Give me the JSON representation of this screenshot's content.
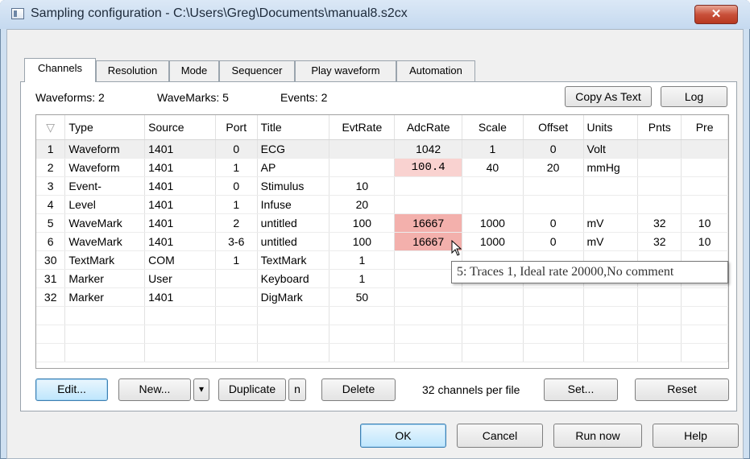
{
  "window": {
    "title": "Sampling configuration - C:\\Users\\Greg\\Documents\\manual8.s2cx",
    "close": "✕"
  },
  "tabs": [
    "Channels",
    "Resolution",
    "Mode",
    "Sequencer",
    "Play waveform",
    "Automation"
  ],
  "summary": {
    "waveforms": "Waveforms: 2",
    "wavemarks": "WaveMarks: 5",
    "events": "Events: 2"
  },
  "top_buttons": {
    "copy": "Copy As Text",
    "log": "Log"
  },
  "table": {
    "sort_indicator": "▽",
    "columns": [
      "Type",
      "Source",
      "Port",
      "Title",
      "EvtRate",
      "AdcRate",
      "Scale",
      "Offset",
      "Units",
      "Pnts",
      "Pre"
    ],
    "rows": [
      {
        "num": "1",
        "type": "Waveform",
        "source": "1401",
        "port": "0",
        "title": "ECG",
        "evtrate": "",
        "adcrate": "1042",
        "scale": "1",
        "offset": "0",
        "units": "Volt",
        "pnts": "",
        "pre": ""
      },
      {
        "num": "2",
        "type": "Waveform",
        "source": "1401",
        "port": "1",
        "title": "AP",
        "evtrate": "",
        "adcrate": "100.4",
        "scale": "40",
        "offset": "20",
        "units": "mmHg",
        "pnts": "",
        "pre": ""
      },
      {
        "num": "3",
        "type": "Event-",
        "source": "1401",
        "port": "0",
        "title": "Stimulus",
        "evtrate": "10",
        "adcrate": "",
        "scale": "",
        "offset": "",
        "units": "",
        "pnts": "",
        "pre": ""
      },
      {
        "num": "4",
        "type": "Level",
        "source": "1401",
        "port": "1",
        "title": "Infuse",
        "evtrate": "20",
        "adcrate": "",
        "scale": "",
        "offset": "",
        "units": "",
        "pnts": "",
        "pre": ""
      },
      {
        "num": "5",
        "type": "WaveMark",
        "source": "1401",
        "port": "2",
        "title": "untitled",
        "evtrate": "100",
        "adcrate": "16667",
        "scale": "1000",
        "offset": "0",
        "units": "mV",
        "pnts": "32",
        "pre": "10"
      },
      {
        "num": "6",
        "type": "WaveMark",
        "source": "1401",
        "port": "3-6",
        "title": "untitled",
        "evtrate": "100",
        "adcrate": "16667",
        "scale": "1000",
        "offset": "0",
        "units": "mV",
        "pnts": "32",
        "pre": "10"
      },
      {
        "num": "30",
        "type": "TextMark",
        "source": "COM",
        "port": "1",
        "title": "TextMark",
        "evtrate": "1",
        "adcrate": "",
        "scale": "",
        "offset": "",
        "units": "",
        "pnts": "",
        "pre": ""
      },
      {
        "num": "31",
        "type": "Marker",
        "source": "User",
        "port": "",
        "title": "Keyboard",
        "evtrate": "1",
        "adcrate": "",
        "scale": "",
        "offset": "",
        "units": "",
        "pnts": "",
        "pre": ""
      },
      {
        "num": "32",
        "type": "Marker",
        "source": "1401",
        "port": "",
        "title": "DigMark",
        "evtrate": "50",
        "adcrate": "",
        "scale": "",
        "offset": "",
        "units": "",
        "pnts": "",
        "pre": ""
      }
    ]
  },
  "tooltip": "5: Traces 1, Ideal rate 20000,No comment",
  "bottom_bar": {
    "edit": "Edit...",
    "new": "New...",
    "new_dropdown": "▾",
    "duplicate": "Duplicate",
    "n": "n",
    "delete": "Delete",
    "channels_per_file": "32 channels per file",
    "set": "Set...",
    "reset": "Reset"
  },
  "dialog_buttons": {
    "ok": "OK",
    "cancel": "Cancel",
    "run_now": "Run now",
    "help": "Help"
  },
  "colors": {
    "highlight_light": "#f9d2d0",
    "highlight_dark": "#f3b0ac",
    "close_button": "#c9503a"
  }
}
